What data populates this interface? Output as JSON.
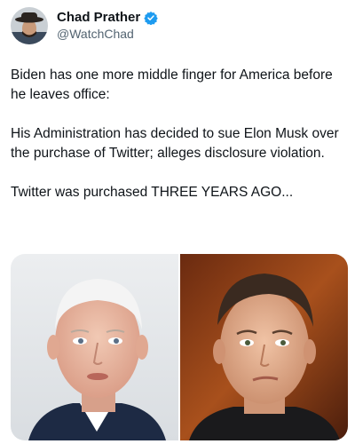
{
  "author": {
    "display_name": "Chad Prather",
    "handle": "@WatchChad",
    "verified": true,
    "avatar_icon": "avatar-cowboy-hat",
    "verified_color": "#1d9bf0"
  },
  "tweet": {
    "paragraphs": [
      "Biden has one more middle finger for America before he leaves office:",
      "His Administration has decided to sue Elon Musk over the purchase of Twitter; alleges disclosure violation.",
      "Twitter was purchased THREE YEARS AGO..."
    ]
  },
  "media": {
    "images": [
      {
        "subject": "photo-older-man-white-hair"
      },
      {
        "subject": "photo-man-dark-hair"
      }
    ]
  }
}
